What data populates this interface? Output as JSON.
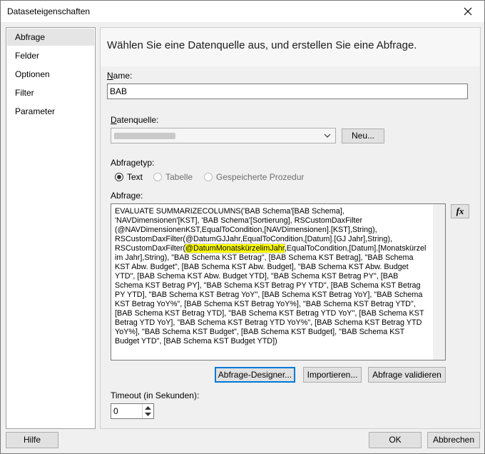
{
  "window": {
    "title": "Dataseteigenschaften"
  },
  "nav": {
    "items": [
      "Abfrage",
      "Felder",
      "Optionen",
      "Filter",
      "Parameter"
    ]
  },
  "main": {
    "heading": "Wählen Sie eine Datenquelle aus, und erstellen Sie eine Abfrage.",
    "name_label": "Name:",
    "name_value": "BAB",
    "datasource_label": "Datenquelle:",
    "new_button": "Neu...",
    "querytype_label": "Abfragetyp:",
    "querytype_options": [
      "Text",
      "Tabelle",
      "Gespeicherte Prozedur"
    ],
    "querytype_selected": "Text",
    "query_label": "Abfrage:",
    "query_before": "EVALUATE SUMMARIZECOLUMNS('BAB Schema'[BAB Schema], 'NAVDimensionen'[KST], 'BAB Schema'[Sortierung], RSCustomDaxFilter (@NAVDimensionenKST,EqualToCondition,[NAVDimensionen].[KST],String), RSCustomDaxFilter(@DatumGJJahr,EqualToCondition,[Datum].[GJ Jahr],String), RSCustomDaxFilter(",
    "query_highlight": "@DatumMonatskürzelimJahr",
    "query_after": ",EqualToCondition,[Datum].[Monatskürzel im Jahr],String), \"BAB Schema KST Betrag\", [BAB Schema KST Betrag], \"BAB Schema KST Abw. Budget\", [BAB Schema KST Abw. Budget], \"BAB Schema KST Abw. Budget YTD\", [BAB Schema KST Abw. Budget YTD], \"BAB Schema KST Betrag PY\", [BAB Schema KST Betrag PY], \"BAB Schema KST Betrag PY YTD\", [BAB Schema KST Betrag PY YTD], \"BAB Schema KST Betrag YoY\", [BAB Schema KST Betrag YoY], \"BAB Schema KST Betrag YoY%\", [BAB Schema KST Betrag YoY%], \"BAB Schema KST Betrag YTD\", [BAB Schema KST Betrag YTD], \"BAB Schema KST Betrag YTD YoY\", [BAB Schema KST Betrag YTD YoY], \"BAB Schema KST Betrag YTD YoY%\", [BAB Schema KST Betrag YTD YoY%], \"BAB Schema KST Budget\", [BAB Schema KST Budget], \"BAB Schema KST Budget YTD\", [BAB Schema KST Budget YTD])",
    "fx_label": "fx",
    "designer_button": "Abfrage-Designer...",
    "import_button": "Importieren...",
    "validate_button": "Abfrage validieren",
    "timeout_label": "Timeout (in Sekunden):",
    "timeout_value": "0"
  },
  "footer": {
    "help_button": "Hilfe",
    "ok_button": "OK",
    "cancel_button": "Abbrechen"
  }
}
